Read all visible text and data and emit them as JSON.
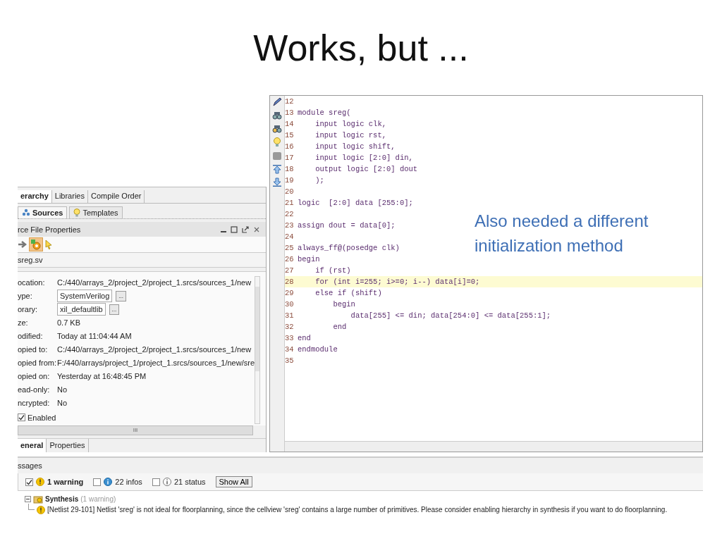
{
  "slide_title": "Works, but ...",
  "annotation": "Also needed a different initialization method",
  "left_panel": {
    "tabs": [
      {
        "label": "erarchy",
        "selected": true
      },
      {
        "label": "Libraries",
        "selected": false
      },
      {
        "label": "Compile Order",
        "selected": false
      }
    ],
    "subtabs": [
      {
        "label": "Sources",
        "selected": true,
        "kind": "sources"
      },
      {
        "label": "Templates",
        "selected": false,
        "kind": "templates"
      }
    ],
    "properties_panel": {
      "title": "rce File Properties",
      "file_name": "sreg.sv",
      "properties": [
        {
          "label": "ocation:",
          "value": "C:/440/arrays_2/project_2/project_1.srcs/sources_1/new",
          "kind": "text"
        },
        {
          "label": "ype:",
          "value": "SystemVerilog",
          "kind": "picker"
        },
        {
          "label": "orary:",
          "value": "xil_defaultlib",
          "kind": "picker"
        },
        {
          "label": "ze:",
          "value": "0.7 KB",
          "kind": "text"
        },
        {
          "label": "odified:",
          "value": "Today at 11:04:44 AM",
          "kind": "text"
        },
        {
          "label": "opied to:",
          "value": "C:/440/arrays_2/project_2/project_1.srcs/sources_1/new",
          "kind": "text"
        },
        {
          "label": "opied from:",
          "value": "F:/440/arrays/project_1/project_1.srcs/sources_1/new/sre",
          "kind": "text"
        },
        {
          "label": "opied on:",
          "value": "Yesterday at 16:48:45 PM",
          "kind": "text"
        },
        {
          "label": "ead-only:",
          "value": "No",
          "kind": "text"
        },
        {
          "label": "ncrypted:",
          "value": "No",
          "kind": "text"
        }
      ],
      "enabled": {
        "label": "Enabled",
        "checked": true
      },
      "picker_button": "...",
      "scroll_grip": "III"
    },
    "bottom_tabs": [
      {
        "label": "eneral",
        "selected": true
      },
      {
        "label": "Properties",
        "selected": false
      }
    ]
  },
  "editor": {
    "lines": [
      {
        "number": "12",
        "highlighted": false
      },
      {
        "number": "13",
        "code": "module sreg(",
        "highlighted": false
      },
      {
        "number": "14",
        "code": "    input logic clk,",
        "highlighted": false
      },
      {
        "number": "15",
        "code": "    input logic rst,",
        "highlighted": false
      },
      {
        "number": "16",
        "code": "    input logic shift,",
        "highlighted": false
      },
      {
        "number": "17",
        "code": "    input logic [2:0] din,",
        "highlighted": false
      },
      {
        "number": "18",
        "code": "    output logic [2:0] dout",
        "highlighted": false
      },
      {
        "number": "19",
        "code": "    );",
        "highlighted": false
      },
      {
        "number": "20",
        "highlighted": false
      },
      {
        "number": "21",
        "code": "logic  [2:0] data [255:0];",
        "highlighted": false
      },
      {
        "number": "22",
        "highlighted": false
      },
      {
        "number": "23",
        "code": "assign dout = data[0];",
        "highlighted": false
      },
      {
        "number": "24",
        "highlighted": false
      },
      {
        "number": "25",
        "code": "always_ff@(posedge clk)",
        "highlighted": false
      },
      {
        "number": "26",
        "code": "begin",
        "highlighted": false
      },
      {
        "number": "27",
        "code": "    if (rst)",
        "highlighted": false
      },
      {
        "number": "28",
        "code": "    for (int i=255; i>=0; i--) data[i]=0;",
        "highlighted": true
      },
      {
        "number": "29",
        "code": "    else if (shift)",
        "highlighted": false
      },
      {
        "number": "30",
        "code": "        begin",
        "highlighted": false
      },
      {
        "number": "31",
        "code": "            data[255] <= din; data[254:0] <= data[255:1];",
        "highlighted": false
      },
      {
        "number": "32",
        "code": "        end",
        "highlighted": false
      },
      {
        "number": "33",
        "code": "end",
        "highlighted": false
      },
      {
        "number": "34",
        "code": "endmodule",
        "highlighted": false
      },
      {
        "number": "35",
        "highlighted": false
      }
    ]
  },
  "messages": {
    "title": "ssages",
    "filters": [
      {
        "label": "1 warning",
        "checked": true,
        "kind": "warning"
      },
      {
        "label": "22 infos",
        "checked": false,
        "kind": "info"
      },
      {
        "label": "21 status",
        "checked": false,
        "kind": "status"
      }
    ],
    "show_all": "Show All",
    "tree": [
      {
        "label": "Synthesis",
        "note": "(1 warning)",
        "expanded": true,
        "children": [
          {
            "text": "[Netlist 29-101] Netlist 'sreg' is not ideal for floorplanning, since the cellview 'sreg' contains a large number of primitives. Please consider enabling hierarchy in synthesis if you want to do floorplanning."
          }
        ]
      }
    ]
  }
}
